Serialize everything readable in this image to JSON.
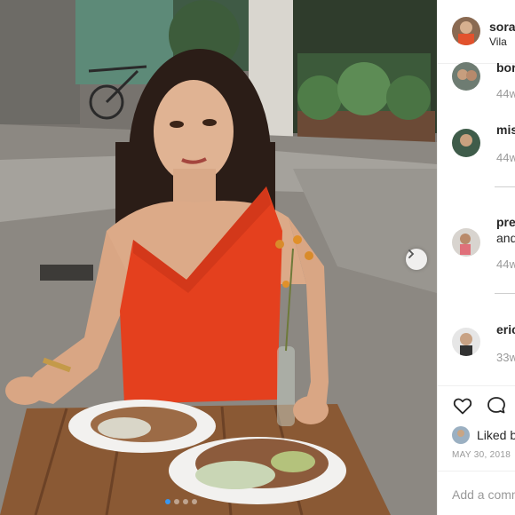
{
  "post": {
    "username": "sora",
    "location": "Vila",
    "carousel": {
      "current_slide": 1,
      "total_slides": 4
    }
  },
  "icons": {
    "next": "chevron-right-icon",
    "like": "heart-icon",
    "comment": "speech-bubble-icon"
  },
  "comments": [
    {
      "name": "bor",
      "text": "",
      "time": "44w"
    },
    {
      "name": "mis",
      "text": "",
      "time": "44w"
    },
    {
      "name": "pre",
      "text": "and",
      "time": "44w"
    },
    {
      "name": "eric",
      "text": "",
      "time": "33w"
    }
  ],
  "likes": {
    "label": "Liked b"
  },
  "date": "MAY 30, 2018",
  "add_comment": {
    "placeholder": "Add a comm"
  },
  "colors": {
    "accent": "#3897f0",
    "muted": "#999999",
    "text": "#262626"
  }
}
